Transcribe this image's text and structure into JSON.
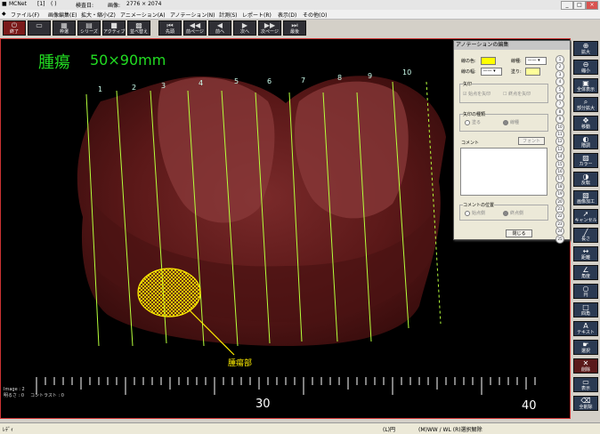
{
  "titlebar": {
    "app": "MCNet",
    "doc": "[1]",
    "paren": "( )",
    "exam_label": "検査日:",
    "image_label": "画像:",
    "image_size": "2776 × 2074"
  },
  "window_buttons": [
    "_",
    "□",
    "×"
  ],
  "menu": [
    "ファイル(F)",
    "画像編集(E)",
    "拡大・縮小(Z)",
    "アニメーション(A)",
    "アノテーション(N)",
    "計測(S)",
    "レポート(R)",
    "表示(D)",
    "その他(O)"
  ],
  "toolbar": [
    {
      "label": "終了",
      "icon": "exit-icon"
    },
    {
      "label": "",
      "icon": "blank-icon"
    },
    {
      "label": "枠選",
      "icon": "grid-icon"
    },
    {
      "label": "シリーズ",
      "icon": "series-icon"
    },
    {
      "label": "アクティブ",
      "icon": "active-icon"
    },
    {
      "label": "並べ替え",
      "icon": "sort-icon"
    },
    {
      "label": "先頭",
      "icon": "first-icon"
    },
    {
      "label": "前ページ",
      "icon": "prev-page-icon"
    },
    {
      "label": "前へ",
      "icon": "prev-icon"
    },
    {
      "label": "次へ",
      "icon": "next-icon"
    },
    {
      "label": "次ページ",
      "icon": "next-page-icon"
    },
    {
      "label": "最後",
      "icon": "last-icon"
    }
  ],
  "viewer": {
    "caption_left": "腫瘍",
    "caption_right": "50×90mm",
    "slice_labels": [
      "1",
      "2",
      "3",
      "4",
      "5",
      "6",
      "7",
      "8",
      "9",
      "10"
    ],
    "annotation": "腫瘍部",
    "ruler_labels": [
      "30",
      "40"
    ],
    "overlay_image": "Image : 2",
    "overlay_brightness": "明るさ : 0",
    "overlay_contrast": "コントラスト : 0",
    "label_color": "#22dd22",
    "annotation_color": "#ffff00"
  },
  "dialog": {
    "title": "アノテーションの編集",
    "line_color": "線の色:",
    "line_type": "線種:",
    "line_width": "線の幅:",
    "fill": "塗り:",
    "arrow_group": "矢印",
    "arrow_start": "始点を矢印",
    "arrow_end": "終点を矢印",
    "arrow_kind_group": "矢印の種類",
    "arrow_kind_a": "塗る",
    "arrow_kind_b": "線種",
    "comment": "コメント",
    "font": "フォント",
    "comment_pos_group": "コメントの位置",
    "pos_start": "始点側",
    "pos_end": "終点側",
    "close": "閉じる",
    "swatch_color": "#ffff00",
    "fill_color": "#ffff99",
    "numbers": [
      "1",
      "2",
      "3",
      "4",
      "5",
      "6",
      "7",
      "8",
      "9",
      "10",
      "11",
      "12",
      "13",
      "14",
      "15",
      "16",
      "17",
      "18",
      "19",
      "20",
      "21",
      "22",
      "23",
      "24",
      "25"
    ]
  },
  "palette": [
    {
      "label": "拡大",
      "icon": "zoom-in-icon"
    },
    {
      "label": "縮小",
      "icon": "zoom-out-icon"
    },
    {
      "label": "全体表示",
      "icon": "fit-icon"
    },
    {
      "label": "部分拡大",
      "icon": "magnify-icon"
    },
    {
      "label": "移動",
      "icon": "move-icon"
    },
    {
      "label": "階調",
      "icon": "contrast-icon"
    },
    {
      "label": "カラー",
      "icon": "color-icon"
    },
    {
      "label": "反転",
      "icon": "invert-icon"
    },
    {
      "label": "画像加工",
      "icon": "process-icon"
    },
    {
      "label": "キャンセル",
      "icon": "cursor-icon"
    },
    {
      "label": "長さ",
      "icon": "length-icon"
    },
    {
      "label": "距離",
      "icon": "distance-icon"
    },
    {
      "label": "角度",
      "icon": "angle-icon"
    },
    {
      "label": "円",
      "icon": "circle-icon"
    },
    {
      "label": "四角",
      "icon": "rect-icon"
    },
    {
      "label": "テキスト",
      "icon": "text-icon"
    },
    {
      "label": "選択",
      "icon": "select-icon"
    },
    {
      "label": "削除",
      "icon": "delete-icon"
    },
    {
      "label": "表示",
      "icon": "display-icon"
    },
    {
      "label": "全削除",
      "icon": "clear-icon"
    }
  ],
  "status": {
    "left": "ﾚﾃﾞｨ",
    "mode": "(L)円",
    "right": "(M)WW / WL (R)選択解除"
  }
}
